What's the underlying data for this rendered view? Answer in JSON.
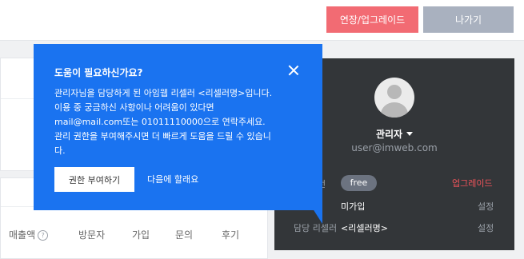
{
  "topbar": {
    "upgrade_label": "연장/업그레이드",
    "exit_label": "나가기"
  },
  "stats_table": {
    "columns": [
      "매출액",
      "방문자",
      "가입",
      "문의",
      "후기"
    ],
    "help_glyph": "?"
  },
  "admin_panel": {
    "name": "관리자",
    "email": "user@imweb.com",
    "plan_label": "전",
    "plan_badge": "free",
    "upgrade_link": "업그레이드",
    "rows": [
      {
        "label": "",
        "value": "미가입",
        "action": "설정"
      },
      {
        "label": "담당 리셀러",
        "value": "<리셀러명>",
        "action": "설정"
      }
    ]
  },
  "help_popover": {
    "title": "도움이 필요하신가요?",
    "lines": [
      "관리자님을 담당하게 된 아임웹 리셀러 <리셀러명>입니다.",
      "이용 중 궁금하신 사항이나 어려움이 있다면",
      "mail@mail.com또는 01011110000으로 연락주세요.",
      "관리 권한을 부여해주시면 더 빠르게 도움을 드릴 수 있습니",
      "다."
    ],
    "grant_button": "권한 부여하기",
    "later_link": "다음에 할래요"
  },
  "colors": {
    "accent": "#1a73f0",
    "upgrade": "#f26b73",
    "exit": "#a9b1bf",
    "panel": "#333639"
  }
}
